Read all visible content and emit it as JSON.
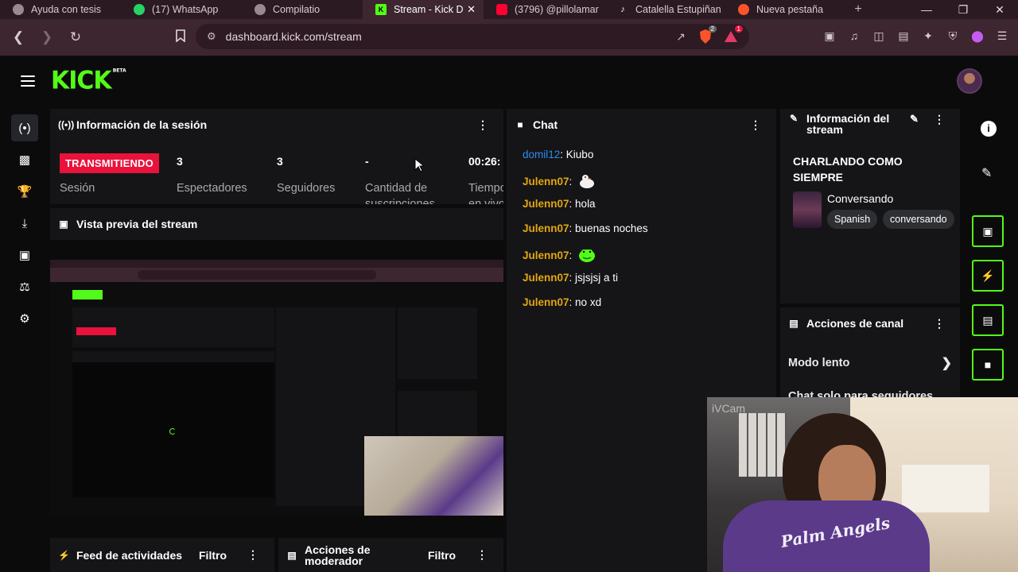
{
  "browser": {
    "tabs": [
      {
        "label": "Ayuda con tesis",
        "icon": "ai-icon",
        "color": "#9a8a90"
      },
      {
        "label": "(17) WhatsApp",
        "icon": "whatsapp-icon",
        "color": "#25d366"
      },
      {
        "label": "Compilatio",
        "icon": "globe-icon",
        "color": "#9a8a90"
      },
      {
        "label": "Stream - Kick D",
        "icon": "kick-icon",
        "color": "#53fc18",
        "active": true
      },
      {
        "label": "(3796) @pillolamar",
        "icon": "youtube-icon",
        "color": "#ff0033"
      },
      {
        "label": "Catalella Estupiñan",
        "icon": "tiktok-icon",
        "color": "#ffffff"
      },
      {
        "label": "Nueva pestaña",
        "icon": "brave-icon",
        "color": "#fb542b"
      }
    ],
    "new_tab": "+",
    "url": "dashboard.kick.com/stream",
    "shield_count": "2",
    "rewards_count": "1"
  },
  "kick": {
    "logo": "KICK",
    "logo_badge": "BETA",
    "sidebar": [
      "broadcast-icon",
      "stats-icon",
      "trophy-icon",
      "upload-icon",
      "screen-icon",
      "users-icon",
      "settings-icon"
    ]
  },
  "session": {
    "title": "Información de la sesión",
    "status": "TRANSMITIENDO",
    "status_label": "Sesión",
    "stats": [
      {
        "value": "3",
        "label": "Espectadores"
      },
      {
        "value": "3",
        "label": "Seguidores"
      },
      {
        "value": "-",
        "label": "Cantidad de suscripciones"
      },
      {
        "value": "00:26:",
        "label": "Tiempo en vivo"
      }
    ]
  },
  "preview": {
    "title": "Vista previa del stream"
  },
  "chat": {
    "title": "Chat",
    "messages": [
      {
        "user": "domil12",
        "text": "Kiubo",
        "type": "blue"
      },
      {
        "user": "Julenn07",
        "text": "",
        "emote": "duck",
        "type": "gold"
      },
      {
        "user": "Julenn07",
        "text": "hola",
        "type": "gold"
      },
      {
        "user": "Julenn07",
        "text": "buenas noches",
        "type": "gold"
      },
      {
        "user": "Julenn07",
        "text": "",
        "emote": "frog",
        "type": "gold"
      },
      {
        "user": "Julenn07",
        "text": "jsjsjsj a ti",
        "type": "gold"
      },
      {
        "user": "Julenn07",
        "text": "no xd",
        "type": "gold"
      }
    ]
  },
  "stream_info": {
    "title": "Información del stream",
    "stream_title": "CHARLANDO COMO SIEMPRE",
    "category": "Conversando",
    "tags": [
      "Spanish",
      "conversando"
    ]
  },
  "channel_actions": {
    "title": "Acciones de canal",
    "items": [
      "Modo lento",
      "Chat solo para seguidores"
    ]
  },
  "feed": {
    "title": "Feed de actividades",
    "filter": "Filtro"
  },
  "mod": {
    "title": "Acciones de moderador",
    "filter": "Filtro"
  },
  "webcam": {
    "watermark": "iVCam",
    "shirt_text": "Palm Angels"
  }
}
